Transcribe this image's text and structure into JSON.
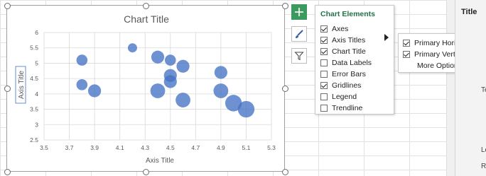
{
  "chart": {
    "title": "Chart Title",
    "x_axis_title": "Axis Title",
    "y_axis_title": "Axis Title",
    "accent": "#4472c4"
  },
  "chart_data": {
    "type": "scatter",
    "title": "Chart Title",
    "xlabel": "Axis Title",
    "ylabel": "Axis Title",
    "xlim": [
      3.5,
      5.3
    ],
    "ylim": [
      2.5,
      6
    ],
    "xticks": [
      "3.5",
      "3.7",
      "3.9",
      "4.1",
      "4.3",
      "4.5",
      "4.7",
      "4.9",
      "5.1",
      "5.3"
    ],
    "yticks": [
      "2.5",
      "3",
      "3.5",
      "4",
      "4.5",
      "5",
      "5.5",
      "6"
    ],
    "grid": true,
    "legend": "none",
    "points": [
      {
        "x": 3.8,
        "y": 5.1,
        "size": 3
      },
      {
        "x": 3.8,
        "y": 4.3,
        "size": 3
      },
      {
        "x": 3.9,
        "y": 4.1,
        "size": 3.5
      },
      {
        "x": 4.2,
        "y": 5.5,
        "size": 2.5
      },
      {
        "x": 4.4,
        "y": 5.2,
        "size": 3.5
      },
      {
        "x": 4.4,
        "y": 4.1,
        "size": 4
      },
      {
        "x": 4.5,
        "y": 5.1,
        "size": 3
      },
      {
        "x": 4.5,
        "y": 4.6,
        "size": 3.5
      },
      {
        "x": 4.5,
        "y": 4.4,
        "size": 3.5
      },
      {
        "x": 4.6,
        "y": 4.9,
        "size": 3.5
      },
      {
        "x": 4.6,
        "y": 3.8,
        "size": 4
      },
      {
        "x": 4.9,
        "y": 4.7,
        "size": 3.5
      },
      {
        "x": 4.9,
        "y": 4.1,
        "size": 4
      },
      {
        "x": 5.0,
        "y": 3.7,
        "size": 4.5
      },
      {
        "x": 5.1,
        "y": 3.5,
        "size": 4.5
      }
    ]
  },
  "side_buttons": {
    "add": {
      "icon": "plus-icon"
    },
    "style": {
      "icon": "paintbrush-icon"
    },
    "filter": {
      "icon": "filter-icon"
    },
    "active_color": "#3c9a5f"
  },
  "flyout": {
    "title": "Chart Elements",
    "title_color": "#217346",
    "items": [
      {
        "label": "Axes",
        "checked": true
      },
      {
        "label": "Axis Titles",
        "checked": true
      },
      {
        "label": "Chart Title",
        "checked": true
      },
      {
        "label": "Data Labels",
        "checked": false
      },
      {
        "label": "Error Bars",
        "checked": false
      },
      {
        "label": "Gridlines",
        "checked": true
      },
      {
        "label": "Legend",
        "checked": false
      },
      {
        "label": "Trendline",
        "checked": false
      }
    ]
  },
  "submenu": {
    "items": [
      {
        "label": "Primary Horizontal",
        "checked": true
      },
      {
        "label": "Primary Vertical",
        "checked": true
      },
      {
        "label": "More Options...",
        "checked": null
      }
    ]
  },
  "pane": {
    "title": "Title",
    "fragments": [
      "Te",
      "Le",
      "Ri"
    ]
  }
}
